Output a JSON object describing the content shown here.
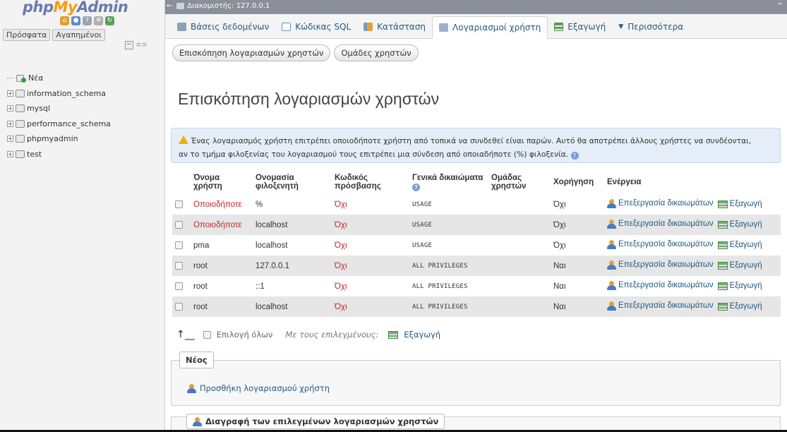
{
  "logo": {
    "php": "php",
    "my": "My",
    "admin": "Admin"
  },
  "sidebar": {
    "tabs": [
      "Πρόσφατα",
      "Αγαπημένοι"
    ],
    "new_label": "Νέα",
    "databases": [
      "information_schema",
      "mysql",
      "performance_schema",
      "phpmyadmin",
      "test"
    ]
  },
  "topbar": {
    "server_label": "Διακομιστής: 127.0.0.1"
  },
  "menu": {
    "tabs": [
      {
        "label": "Βάσεις δεδομένων",
        "icon": "database-icon",
        "color": "#8ea0b5"
      },
      {
        "label": "Κώδικας SQL",
        "icon": "sql-icon",
        "color": "#6d8fbf"
      },
      {
        "label": "Κατάσταση",
        "icon": "status-icon",
        "color": "#7a9bc4"
      },
      {
        "label": "Λογαριασμοί χρήστη",
        "icon": "users-icon",
        "color": "#9fb0c8"
      },
      {
        "label": "Εξαγωγή",
        "icon": "export-icon",
        "color": "#5aa05a"
      },
      {
        "label": "Περισσότερα",
        "icon": "more-icon",
        "color": "#235a81"
      }
    ],
    "active_index": 3
  },
  "subtabs": [
    "Επισκόπηση λογαριασμών χρηστών",
    "Ομάδες χρηστών"
  ],
  "page_title": "Επισκόπηση λογαριασμών χρηστών",
  "notice": {
    "line1": "Ένας λογαριασμός χρήστη επιτρέπει οποιοδήποτε χρήστη από τοπικά να συνδεθεί είναι παρών. Αυτό θα αποτρέπει άλλους χρήστες να συνδέονται,",
    "line2": "αν το τμήμα φιλοξενίας του λογαριασμού τους επιτρέπει μια σύνδεση από οποιαδήποτε (%) φιλοξενία."
  },
  "table": {
    "headers": {
      "user": "Όνομα χρήστη",
      "host": "Ονομασία φιλοξενητή",
      "password": "Κωδικός πρόσβασης",
      "global_privs": "Γενικά δικαιώματα",
      "user_group": "Ομάδας χρηστών",
      "grant": "Χορήγηση",
      "action": "Ενέργεια"
    },
    "rows": [
      {
        "user": "Οποιοδήποτε",
        "host": "%",
        "password": "Όχι",
        "privs": "USAGE",
        "group": "",
        "grant": "Όχι",
        "user_red": true
      },
      {
        "user": "Οποιοδήποτε",
        "host": "localhost",
        "password": "Όχι",
        "privs": "USAGE",
        "group": "",
        "grant": "Όχι",
        "user_red": true
      },
      {
        "user": "pma",
        "host": "localhost",
        "password": "Όχι",
        "privs": "USAGE",
        "group": "",
        "grant": "Όχι",
        "user_red": false
      },
      {
        "user": "root",
        "host": "127.0.0.1",
        "password": "Όχι",
        "privs": "ALL PRIVILEGES",
        "group": "",
        "grant": "Ναι",
        "user_red": false
      },
      {
        "user": "root",
        "host": "::1",
        "password": "Όχι",
        "privs": "ALL PRIVILEGES",
        "group": "",
        "grant": "Ναι",
        "user_red": false
      },
      {
        "user": "root",
        "host": "localhost",
        "password": "Όχι",
        "privs": "ALL PRIVILEGES",
        "group": "",
        "grant": "Ναι",
        "user_red": false
      }
    ],
    "edit_label": "Επεξεργασία δικαιωμάτων",
    "export_label": "Εξαγωγή"
  },
  "bulk": {
    "select_all": "Επιλογή όλων",
    "with_selected": "Με τους επιλεγμένους:",
    "export": "Εξαγωγή"
  },
  "new_section": {
    "legend": "Νέος",
    "add_user": "Προσθήκη λογαριασμού χρήστη"
  },
  "delete_section": {
    "legend": "Διαγραφή των επιλεγμένων λογαριασμών χρηστών"
  },
  "colors": {
    "link": "#235a81",
    "red_text": "#c0272d",
    "topbar": "#8a8f99",
    "notice_bg": "#e4edf8"
  }
}
